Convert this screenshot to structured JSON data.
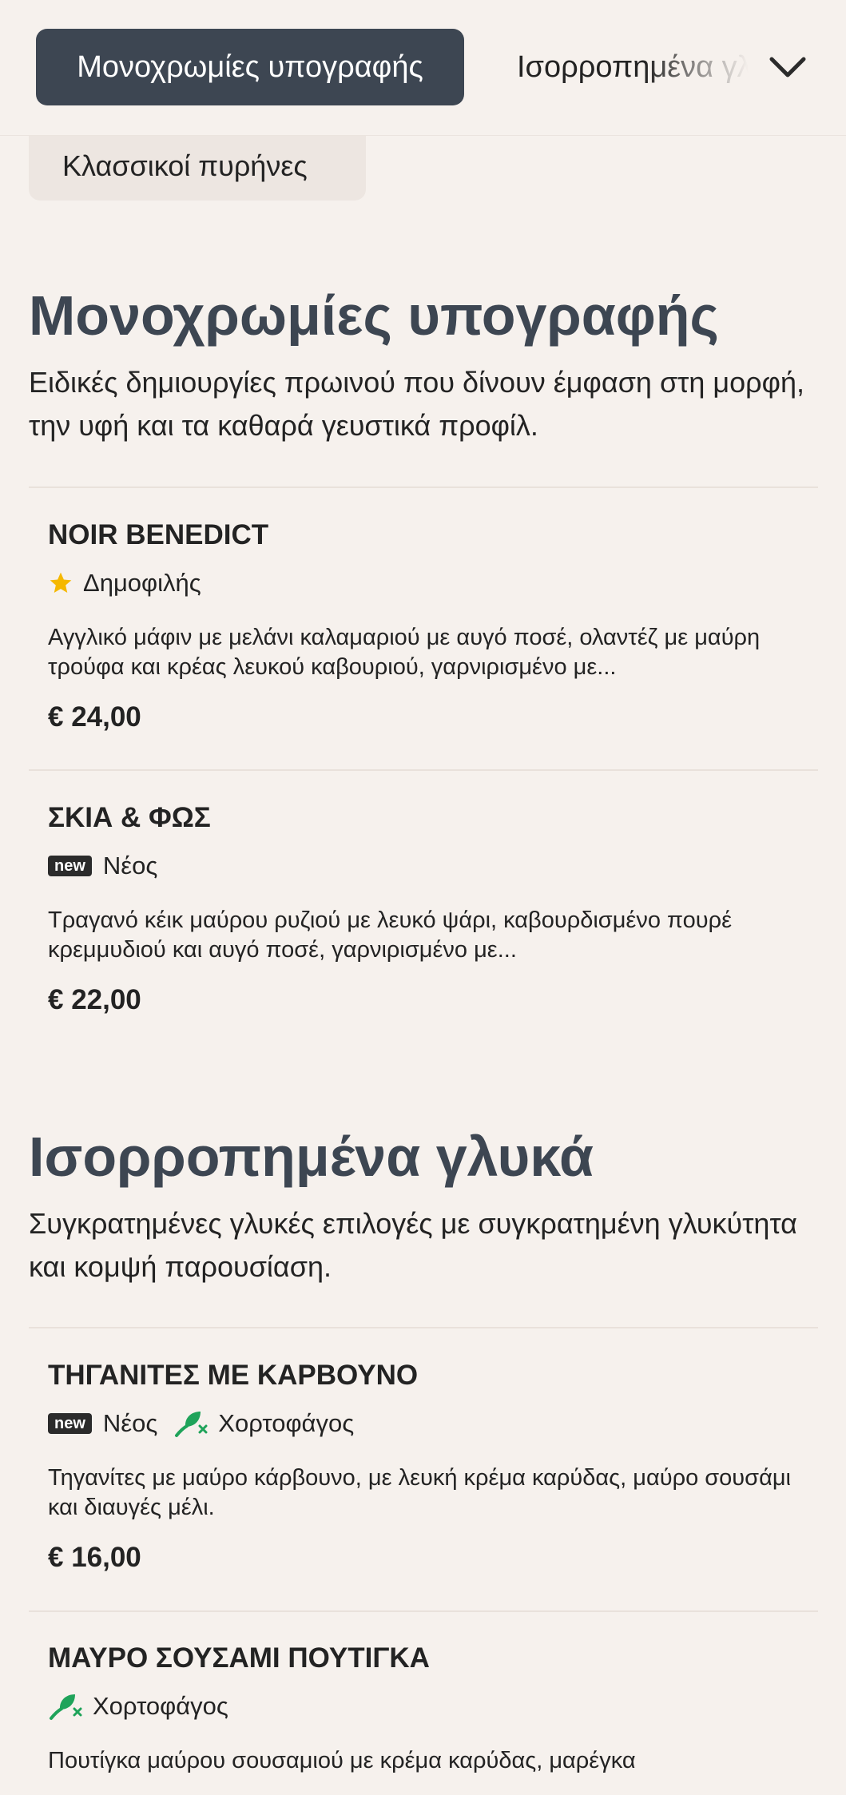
{
  "nav": {
    "active_tab": "Μονοχρωμίες υπογραφής",
    "next_tab": "Ισορροπημένα γλυκά",
    "pill_tab": "Κλασσικοί πυρήνες"
  },
  "sections": [
    {
      "title": "Μονοχρωμίες υπογραφής",
      "description": "Ειδικές δημιουργίες πρωινού που δίνουν έμφαση στη μορφή, την υφή και τα καθαρά γευστικά προφίλ.",
      "items": [
        {
          "name": "NOIR BENEDICT",
          "badge_popular": "Δημοφιλής",
          "description": "Αγγλικό μάφιν με μελάνι καλαμαριού με αυγό ποσέ, ολαντέζ με μαύρη τρούφα και κρέας λευκού καβουριού, γαρνιρισμένο με...",
          "price": "€ 24,00"
        },
        {
          "name": "ΣΚΙΑ & ΦΩΣ",
          "badge_new_tag": "new",
          "badge_new": "Νέος",
          "description": "Τραγανό κέικ μαύρου ρυζιού με λευκό ψάρι, καβουρδισμένο πουρέ κρεμμυδιού και αυγό ποσέ, γαρνιρισμένο με...",
          "price": "€ 22,00"
        }
      ]
    },
    {
      "title": "Ισορροπημένα γλυκά",
      "description": "Συγκρατημένες γλυκές επιλογές με συγκρατημένη γλυκύτητα και κομψή παρουσίαση.",
      "items": [
        {
          "name": "ΤΗΓΑΝΙΤΕΣ ΜΕ ΚΑΡΒΟΥΝΟ",
          "badge_new_tag": "new",
          "badge_new": "Νέος",
          "badge_veg": "Χορτοφάγος",
          "description": "Τηγανίτες με μαύρο κάρβουνο, με λευκή κρέμα καρύδας, μαύρο σουσάμι και διαυγές μέλι.",
          "price": "€ 16,00"
        },
        {
          "name": "ΜΑΥΡΟ ΣΟΥΣΑΜΙ ΠΟΥΤΙΓΚΑ",
          "badge_veg": "Χορτοφάγος",
          "description": "Πουτίγκα μαύρου σουσαμιού με κρέμα καρύδας, μαρέγκα",
          "price": ""
        }
      ]
    }
  ],
  "colors": {
    "background": "#f6f1ed",
    "accent": "#3d4652",
    "star": "#f5b800",
    "veg": "#1fa35a"
  },
  "icons": {
    "chevron": "chevron-down-icon",
    "popular": "star-icon",
    "vegetarian": "leaf-icon"
  }
}
